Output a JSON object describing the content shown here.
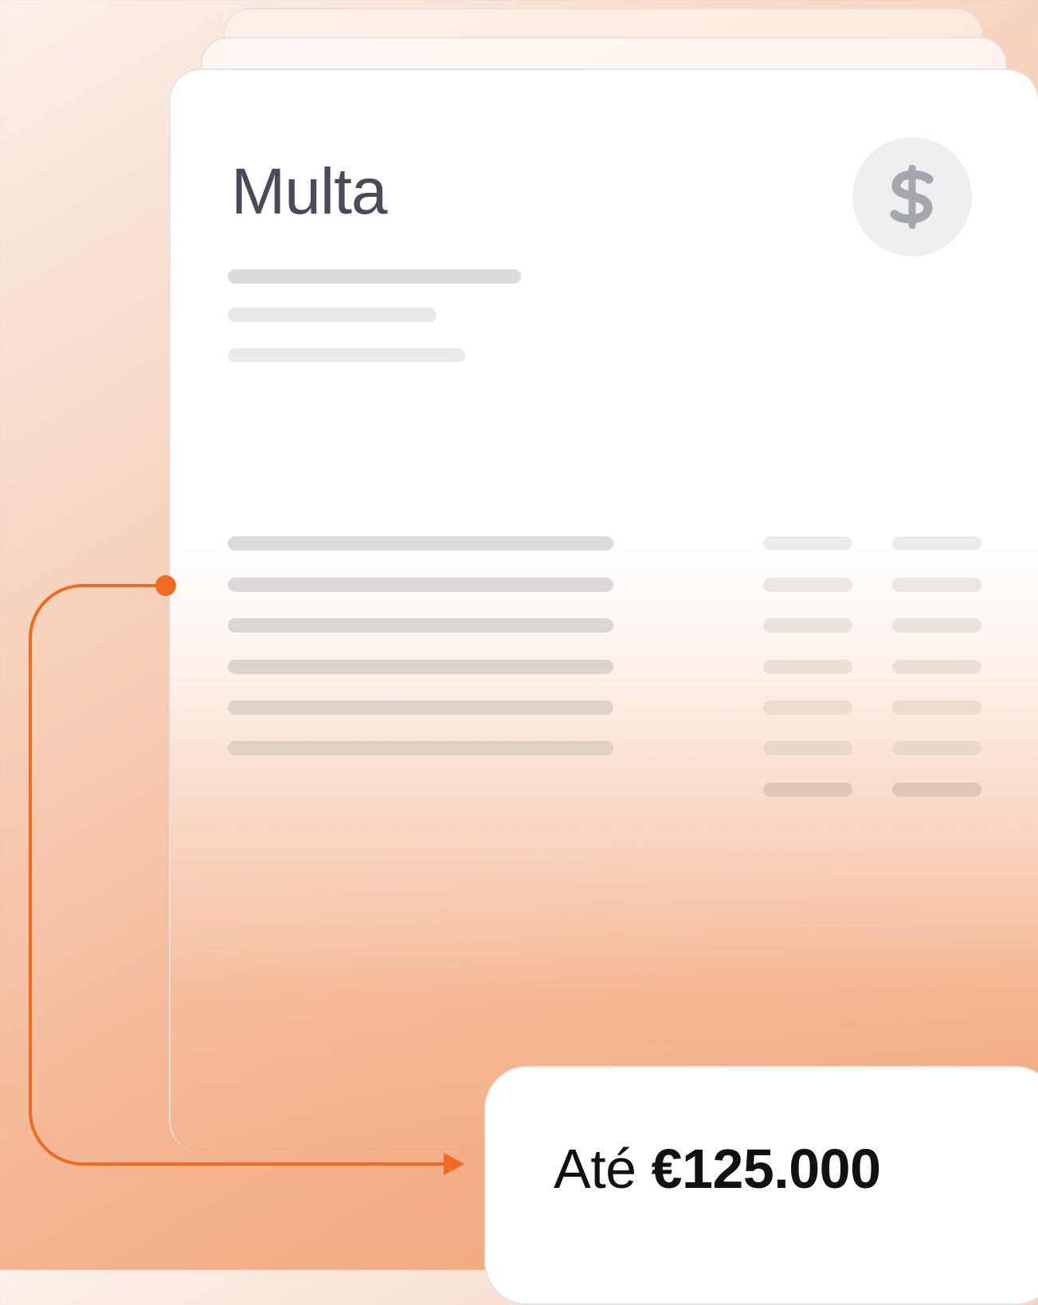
{
  "card": {
    "title": "Multa",
    "icon": "dollar-icon"
  },
  "fine": {
    "prefix": "Até",
    "amount": "€125.000"
  },
  "colors": {
    "accent": "#ef6a22",
    "title_text": "#4a4a5a",
    "icon_glyph": "#a6a6ae",
    "icon_bg": "#efeff1"
  }
}
